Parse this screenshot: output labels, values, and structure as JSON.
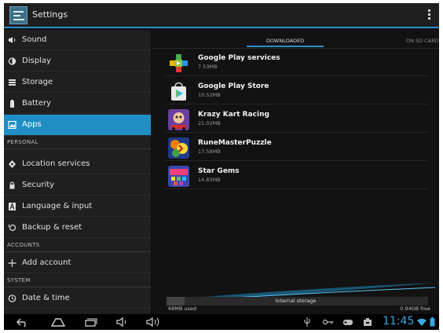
{
  "header": {
    "title": "Settings",
    "icon": "settings-app-icon",
    "overflow_icon": "overflow-menu-icon"
  },
  "sidebar": {
    "items": [
      {
        "label": "Sound",
        "icon": "sound-icon"
      },
      {
        "label": "Display",
        "icon": "display-icon"
      },
      {
        "label": "Storage",
        "icon": "storage-icon"
      },
      {
        "label": "Battery",
        "icon": "battery-icon"
      },
      {
        "label": "Apps",
        "icon": "apps-icon",
        "active": true
      },
      {
        "label": "Location services",
        "icon": "location-icon"
      },
      {
        "label": "Security",
        "icon": "lock-icon"
      },
      {
        "label": "Language & input",
        "icon": "language-icon"
      },
      {
        "label": "Backup & reset",
        "icon": "backup-icon"
      },
      {
        "label": "Add account",
        "icon": "plus-icon"
      },
      {
        "label": "Date & time",
        "icon": "clock-icon"
      }
    ],
    "headers": {
      "personal": "PERSONAL",
      "accounts": "ACCOUNTS",
      "system": "SYSTEM"
    }
  },
  "tabs": {
    "downloaded": "DOWNLOADED",
    "sdcard": "ON SD CARD"
  },
  "apps": [
    {
      "name": "Google Play services",
      "size": "7.53MB",
      "icon": "play-services-icon"
    },
    {
      "name": "Google Play Store",
      "size": "10.52MB",
      "icon": "play-store-icon"
    },
    {
      "name": "Krazy Kart Racing",
      "size": "21.02MB",
      "icon": "krazy-kart-icon"
    },
    {
      "name": "RuneMasterPuzzle",
      "size": "17.58MB",
      "icon": "rune-master-icon"
    },
    {
      "name": "Star Gems",
      "size": "14.83MB",
      "icon": "star-gems-icon"
    }
  ],
  "storage": {
    "title": "Internal storage",
    "used": "68MB used",
    "free": "0.94GB free",
    "used_fraction": 0.07
  },
  "statusbar": {
    "time": "11:45"
  },
  "colors": {
    "accent": "#1f8ec5",
    "clock": "#39a8e0"
  }
}
